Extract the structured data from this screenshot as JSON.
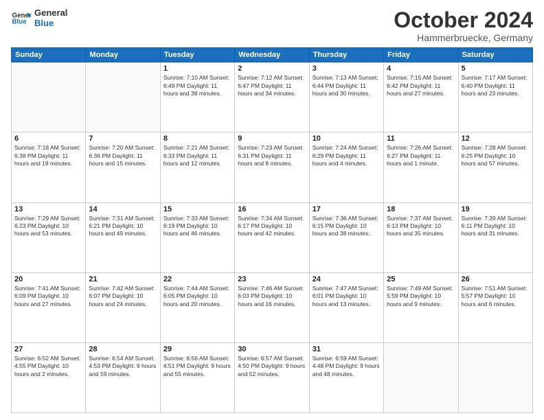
{
  "logo": {
    "line1": "General",
    "line2": "Blue"
  },
  "title": "October 2024",
  "location": "Hammerbruecke, Germany",
  "weekdays": [
    "Sunday",
    "Monday",
    "Tuesday",
    "Wednesday",
    "Thursday",
    "Friday",
    "Saturday"
  ],
  "weeks": [
    [
      {
        "day": "",
        "info": ""
      },
      {
        "day": "",
        "info": ""
      },
      {
        "day": "1",
        "info": "Sunrise: 7:10 AM\nSunset: 6:49 PM\nDaylight: 11 hours and 38 minutes."
      },
      {
        "day": "2",
        "info": "Sunrise: 7:12 AM\nSunset: 6:47 PM\nDaylight: 11 hours and 34 minutes."
      },
      {
        "day": "3",
        "info": "Sunrise: 7:13 AM\nSunset: 6:44 PM\nDaylight: 11 hours and 30 minutes."
      },
      {
        "day": "4",
        "info": "Sunrise: 7:15 AM\nSunset: 6:42 PM\nDaylight: 11 hours and 27 minutes."
      },
      {
        "day": "5",
        "info": "Sunrise: 7:17 AM\nSunset: 6:40 PM\nDaylight: 11 hours and 23 minutes."
      }
    ],
    [
      {
        "day": "6",
        "info": "Sunrise: 7:18 AM\nSunset: 6:38 PM\nDaylight: 11 hours and 19 minutes."
      },
      {
        "day": "7",
        "info": "Sunrise: 7:20 AM\nSunset: 6:36 PM\nDaylight: 11 hours and 15 minutes."
      },
      {
        "day": "8",
        "info": "Sunrise: 7:21 AM\nSunset: 6:33 PM\nDaylight: 11 hours and 12 minutes."
      },
      {
        "day": "9",
        "info": "Sunrise: 7:23 AM\nSunset: 6:31 PM\nDaylight: 11 hours and 8 minutes."
      },
      {
        "day": "10",
        "info": "Sunrise: 7:24 AM\nSunset: 6:29 PM\nDaylight: 11 hours and 4 minutes."
      },
      {
        "day": "11",
        "info": "Sunrise: 7:26 AM\nSunset: 6:27 PM\nDaylight: 11 hours and 1 minute."
      },
      {
        "day": "12",
        "info": "Sunrise: 7:28 AM\nSunset: 6:25 PM\nDaylight: 10 hours and 57 minutes."
      }
    ],
    [
      {
        "day": "13",
        "info": "Sunrise: 7:29 AM\nSunset: 6:23 PM\nDaylight: 10 hours and 53 minutes."
      },
      {
        "day": "14",
        "info": "Sunrise: 7:31 AM\nSunset: 6:21 PM\nDaylight: 10 hours and 49 minutes."
      },
      {
        "day": "15",
        "info": "Sunrise: 7:33 AM\nSunset: 6:19 PM\nDaylight: 10 hours and 46 minutes."
      },
      {
        "day": "16",
        "info": "Sunrise: 7:34 AM\nSunset: 6:17 PM\nDaylight: 10 hours and 42 minutes."
      },
      {
        "day": "17",
        "info": "Sunrise: 7:36 AM\nSunset: 6:15 PM\nDaylight: 10 hours and 38 minutes."
      },
      {
        "day": "18",
        "info": "Sunrise: 7:37 AM\nSunset: 6:13 PM\nDaylight: 10 hours and 35 minutes."
      },
      {
        "day": "19",
        "info": "Sunrise: 7:39 AM\nSunset: 6:11 PM\nDaylight: 10 hours and 31 minutes."
      }
    ],
    [
      {
        "day": "20",
        "info": "Sunrise: 7:41 AM\nSunset: 6:09 PM\nDaylight: 10 hours and 27 minutes."
      },
      {
        "day": "21",
        "info": "Sunrise: 7:42 AM\nSunset: 6:07 PM\nDaylight: 10 hours and 24 minutes."
      },
      {
        "day": "22",
        "info": "Sunrise: 7:44 AM\nSunset: 6:05 PM\nDaylight: 10 hours and 20 minutes."
      },
      {
        "day": "23",
        "info": "Sunrise: 7:46 AM\nSunset: 6:03 PM\nDaylight: 10 hours and 16 minutes."
      },
      {
        "day": "24",
        "info": "Sunrise: 7:47 AM\nSunset: 6:01 PM\nDaylight: 10 hours and 13 minutes."
      },
      {
        "day": "25",
        "info": "Sunrise: 7:49 AM\nSunset: 5:59 PM\nDaylight: 10 hours and 9 minutes."
      },
      {
        "day": "26",
        "info": "Sunrise: 7:51 AM\nSunset: 5:57 PM\nDaylight: 10 hours and 6 minutes."
      }
    ],
    [
      {
        "day": "27",
        "info": "Sunrise: 6:52 AM\nSunset: 4:55 PM\nDaylight: 10 hours and 2 minutes."
      },
      {
        "day": "28",
        "info": "Sunrise: 6:54 AM\nSunset: 4:53 PM\nDaylight: 9 hours and 59 minutes."
      },
      {
        "day": "29",
        "info": "Sunrise: 6:56 AM\nSunset: 4:51 PM\nDaylight: 9 hours and 55 minutes."
      },
      {
        "day": "30",
        "info": "Sunrise: 6:57 AM\nSunset: 4:50 PM\nDaylight: 9 hours and 52 minutes."
      },
      {
        "day": "31",
        "info": "Sunrise: 6:59 AM\nSunset: 4:48 PM\nDaylight: 9 hours and 48 minutes."
      },
      {
        "day": "",
        "info": ""
      },
      {
        "day": "",
        "info": ""
      }
    ]
  ]
}
